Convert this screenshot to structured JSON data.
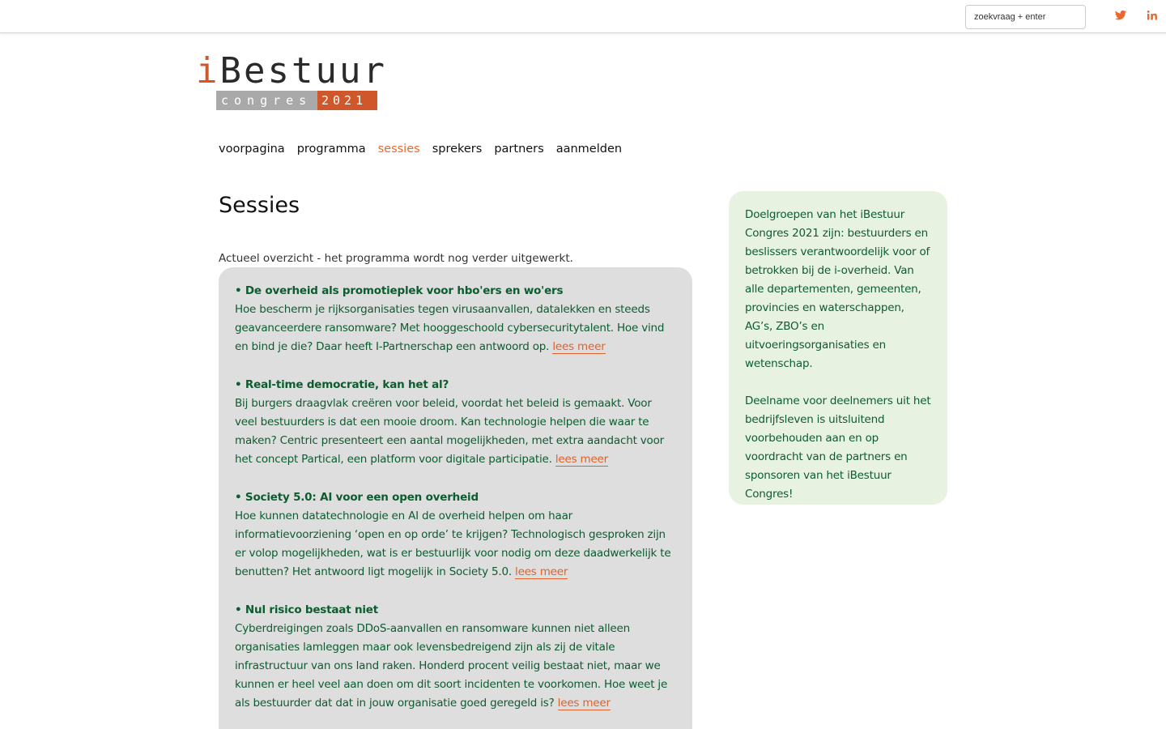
{
  "header": {
    "search_placeholder": "zoekvraag + enter",
    "social": [
      {
        "icon": "twitter-icon",
        "color": "#e8692f"
      },
      {
        "icon": "linkedin-icon",
        "color": "#e8692f"
      }
    ]
  },
  "logo": {
    "i": "i",
    "word": "Bestuur",
    "congres": "congres",
    "year": "2021",
    "accent_color": "#d0572a"
  },
  "nav": {
    "items": [
      {
        "label": "voorpagina",
        "active": false
      },
      {
        "label": "programma",
        "active": false
      },
      {
        "label": "sessies",
        "active": true
      },
      {
        "label": "sprekers",
        "active": false
      },
      {
        "label": "partners",
        "active": false
      },
      {
        "label": "aanmelden",
        "active": false
      }
    ]
  },
  "main": {
    "title": "Sessies",
    "intro": "Actueel overzicht - het programma wordt nog verder uitgewerkt.",
    "link_label": "lees meer",
    "sessions": [
      {
        "title": "• De overheid als promotieplek voor hbo'ers en wo'ers",
        "body": "Hoe bescherm je rijksorganisaties tegen virusaanvallen, datalekken en steeds geavanceerdere ransomware? Met hooggeschoold cybersecuritytalent. Hoe vind en bind je die? Daar heeft I-Partnerschap een antwoord op."
      },
      {
        "title": "• Real-time democratie, kan het al?",
        "body": "Bij burgers draagvlak creëren voor beleid, voordat het beleid is gemaakt. Voor veel bestuurders is dat een mooie droom. Kan technologie helpen die waar te maken? Centric presenteert een aantal mogelijkheden, met extra aandacht voor het concept Partical, een platform voor digitale participatie."
      },
      {
        "title": "• Society 5.0: AI voor een open overheid",
        "body": "Hoe kunnen datatechnologie en AI de overheid helpen om haar informatievoorziening ‘open en op orde’ te krijgen? Technologisch gesproken zijn er volop mogelijkheden, wat is er bestuurlijk voor nodig om deze daadwerkelijk te benutten? Het antwoord ligt mogelijk in Society 5.0."
      },
      {
        "title": "• Nul risico bestaat niet",
        "body": "Cyberdreigingen zoals DDoS-aanvallen en ransomware kunnen niet alleen organisaties lamleggen maar ook levensbedreigend zijn als zij de vitale infrastructuur van ons land raken. Honderd procent veilig bestaat niet, maar we kunnen er heel veel aan doen om dit soort incidenten te voorkomen. Hoe weet je als bestuurder dat dat in jouw organisatie goed geregeld is?"
      }
    ]
  },
  "sidebar": {
    "p1": "Doelgroepen van het iBestuur Congres 2021 zijn: bestuurders en beslissers verantwoordelijk voor of betrokken bij de i-overheid. Van alle departementen, gemeenten, provincies en waterschappen, AG’s, ZBO’s en uitvoeringsorganisaties en wetenschap.",
    "p2": "Deelname voor deelnemers uit het bedrijfsleven is uitsluitend voorbehouden aan en op voordracht van de partners en sponsoren van het iBestuur Congres!"
  },
  "colors": {
    "accent": "#e8692f",
    "text_green": "#0d5c30",
    "sessions_bg": "#dedede",
    "sidebar_bg": "#e8f2e1"
  }
}
